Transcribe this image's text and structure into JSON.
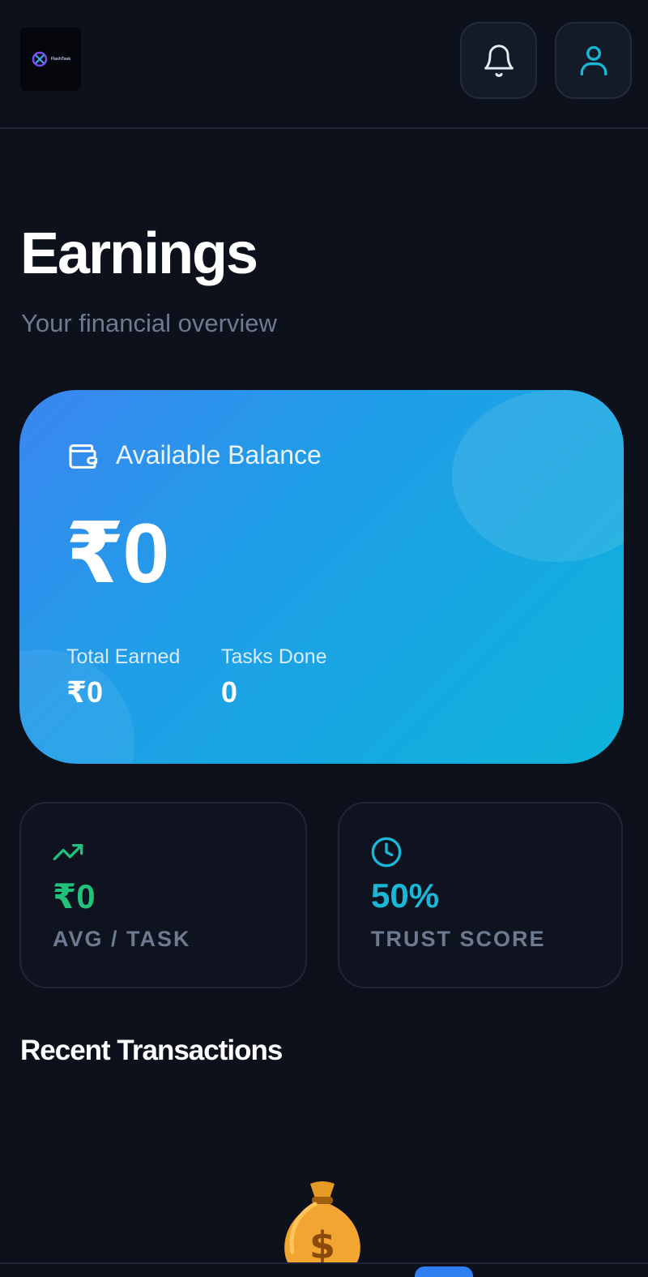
{
  "header": {
    "logo_text": "FlashTask",
    "notification_icon": "bell-icon",
    "profile_icon": "user-icon"
  },
  "page": {
    "title": "Earnings",
    "subtitle": "Your financial overview"
  },
  "balance_card": {
    "icon": "wallet-icon",
    "label": "Available Balance",
    "value": "₹0",
    "stats": [
      {
        "label": "Total Earned",
        "value": "₹0"
      },
      {
        "label": "Tasks Done",
        "value": "0"
      }
    ]
  },
  "metrics": [
    {
      "icon": "trending-up-icon",
      "value": "₹0",
      "label": "AVG / TASK",
      "color": "#21c27a"
    },
    {
      "icon": "clock-icon",
      "value": "50%",
      "label": "TRUST SCORE",
      "color": "#1ab8d8"
    }
  ],
  "transactions": {
    "title": "Recent Transactions",
    "empty_icon": "money-bag-icon"
  },
  "colors": {
    "background": "#0d111c",
    "card_gradient_start": "#3b86f0",
    "card_gradient_end": "#0db3d9",
    "muted_text": "#6d7a90"
  }
}
